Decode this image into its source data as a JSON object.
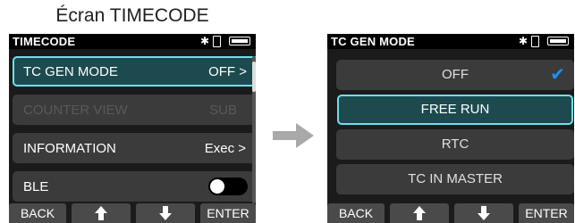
{
  "caption": "Écran TIMECODE",
  "left_screen": {
    "title": "TIMECODE",
    "menu": [
      {
        "label": "TC GEN MODE",
        "value": "OFF >"
      },
      {
        "label": "COUNTER VIEW",
        "value": "SUB"
      },
      {
        "label": "INFORMATION",
        "value": "Exec >"
      },
      {
        "label": "BLE",
        "value": ""
      }
    ],
    "ble_toggle": "off"
  },
  "right_screen": {
    "title": "TC GEN MODE",
    "options": [
      "OFF",
      "FREE RUN",
      "RTC",
      "TC IN MASTER"
    ],
    "checked": "OFF",
    "selected": "FREE RUN"
  },
  "softkeys": {
    "back": "BACK",
    "enter": "ENTER",
    "up_icon": "up-arrow-icon",
    "down_icon": "down-arrow-icon"
  },
  "colors": {
    "highlight_border": "#6ee0ec",
    "highlight_fill": "#1c4a4f",
    "check": "#1e90ff"
  }
}
